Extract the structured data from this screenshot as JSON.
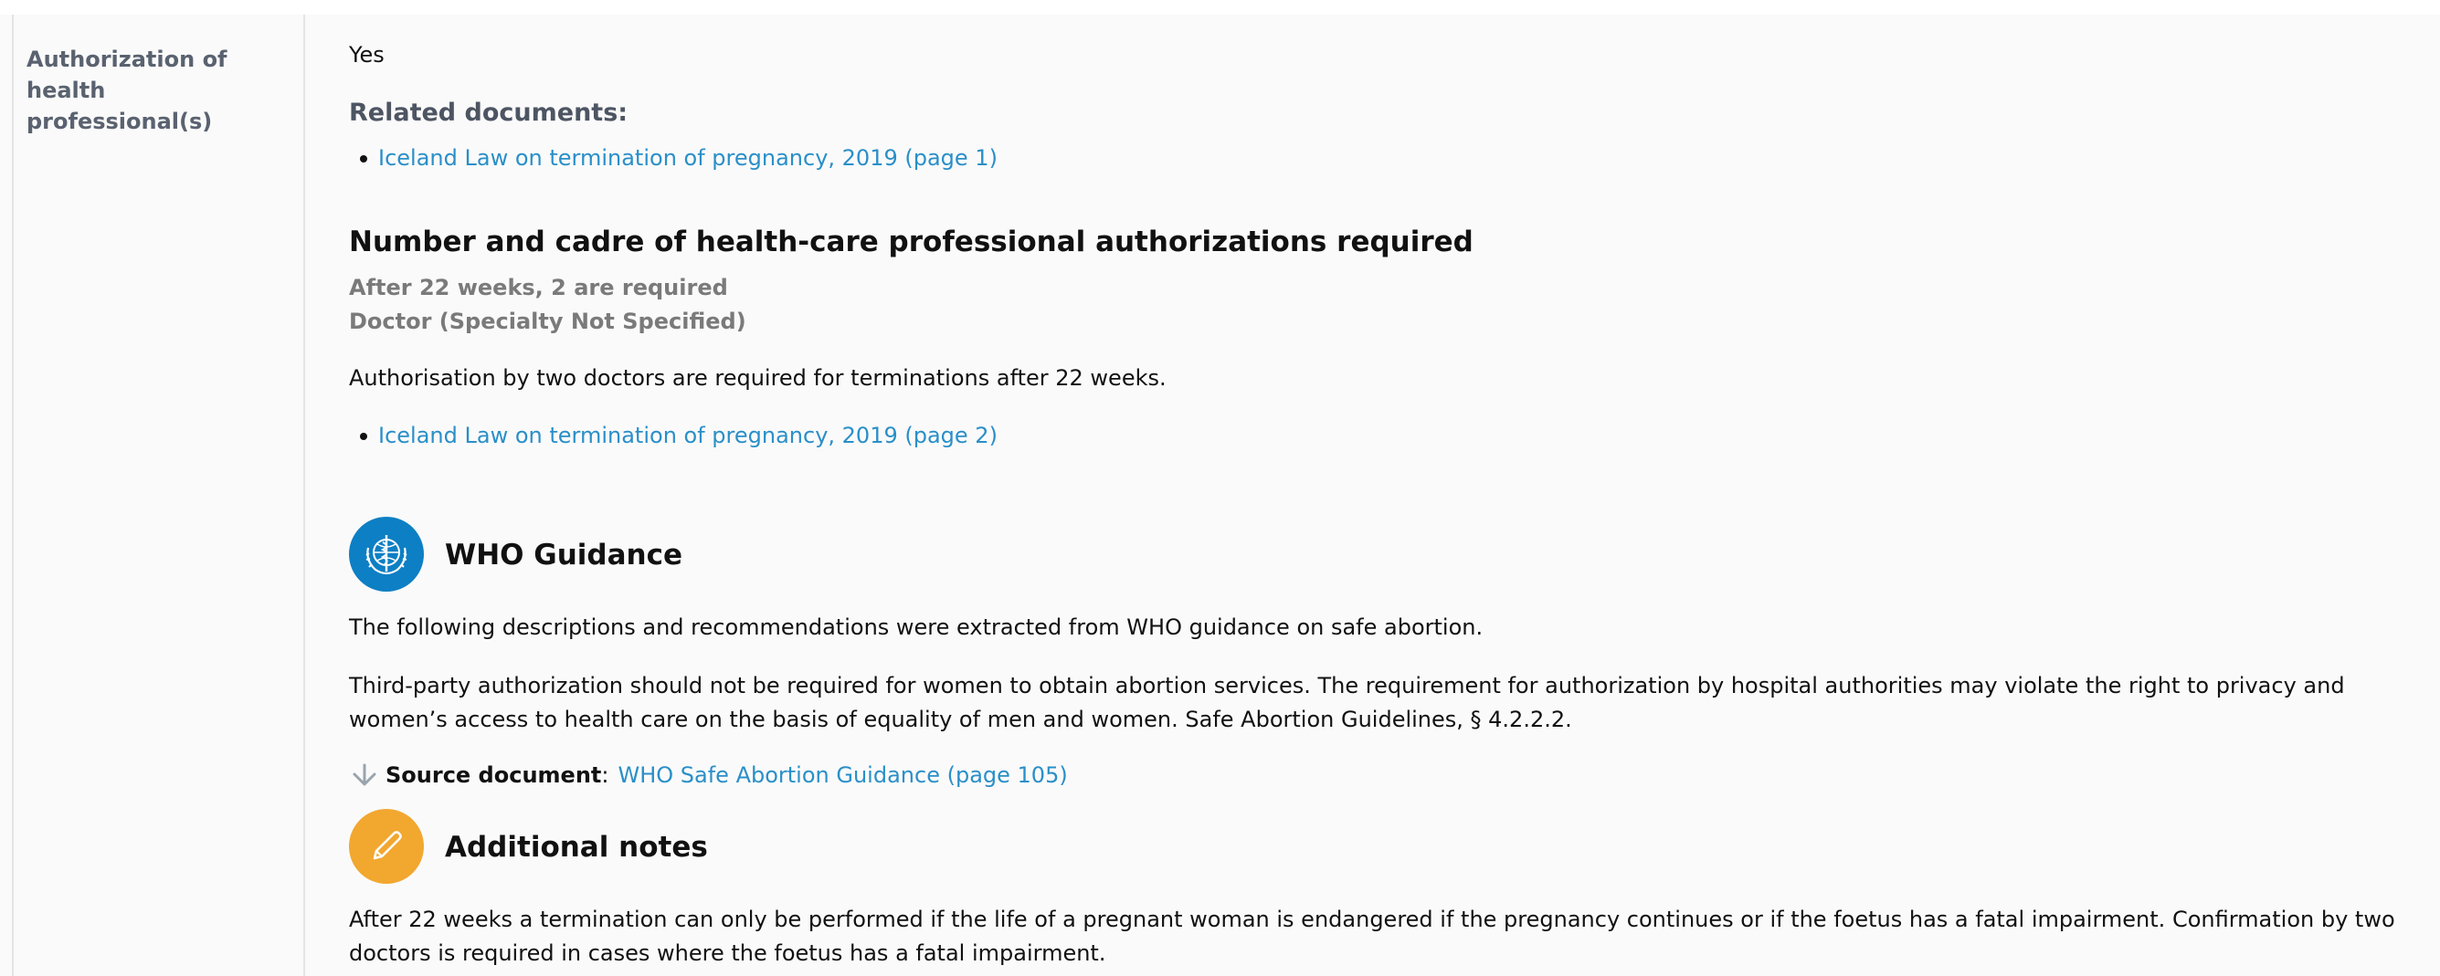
{
  "left_label": "Authorization of health professional(s)",
  "answer": "Yes",
  "related_documents": {
    "heading": "Related documents:",
    "items": [
      "Iceland Law on termination of pregnancy, 2019 (page 1)"
    ]
  },
  "authorizations": {
    "heading": "Number and cadre of health-care professional authorizations required",
    "requirement_count": "After 22 weeks, 2 are required",
    "requirement_cadre": "Doctor (Specialty Not Specified)",
    "description": "Authorisation by two doctors are required for terminations after 22 weeks.",
    "documents": [
      "Iceland Law on termination of pregnancy, 2019 (page 2)"
    ]
  },
  "who_guidance": {
    "icon": "who-emblem-icon",
    "color": "#0d7fc4",
    "heading": "WHO Guidance",
    "intro": "The following descriptions and recommendations were extracted from WHO guidance on safe abortion.",
    "text": "Third-party authorization should not be required for women to obtain abortion services. The requirement for authorization by hospital authorities may violate the right to privacy and women’s access to health care on the basis of equality of men and women. Safe Abortion Guidelines, § 4.2.2.2.",
    "source_label": "Source document",
    "source_separator": ":",
    "source_link": "WHO Safe Abortion Guidance (page 105)"
  },
  "additional_notes": {
    "icon": "pencil-icon",
    "color": "#f2a72f",
    "heading": "Additional notes",
    "text": "After 22 weeks a termination can only be performed if the life of a pregnant woman is endangered if the pregnancy continues or if the foetus has a fatal impairment. Confirmation by two doctors is required in cases where the foetus has a fatal impairment."
  },
  "colors": {
    "link": "#2a8fc8",
    "label_grey": "#5a6270",
    "requirement_grey": "#7a7a7a"
  }
}
